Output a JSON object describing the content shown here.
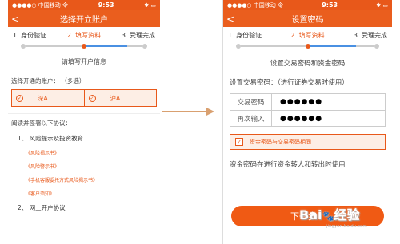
{
  "left_screen": {
    "status": {
      "carrier": "●●●●○ 中国移动 令",
      "time": "9:53",
      "battery": "✱ ▭"
    },
    "nav": {
      "back": "<",
      "title": "选择开立账户"
    },
    "steps": [
      "1. 身份验证",
      "2. 填写资料",
      "3. 受理完成"
    ],
    "subtitle": "请填写开户信息",
    "account_label": "选择开通的账户：  （多选）",
    "accounts": [
      "深A",
      "沪A"
    ],
    "agree_label": "阅读并签署以下协议：",
    "agreements": [
      {
        "title": "1、 风险提示及投资教育",
        "links": [
          "《风险揭示书》",
          "《风险警示书》",
          "《手机客服委托方式风险揭示书》",
          "《客户须知》"
        ]
      },
      {
        "title": "2、 网上开户协议",
        "links": []
      }
    ]
  },
  "right_screen": {
    "status": {
      "carrier": "●●●●○ 中国移动 令",
      "time": "9:53",
      "battery": "✱ ▭"
    },
    "nav": {
      "back": "<",
      "title": "设置密码"
    },
    "steps": [
      "1. 身份验证",
      "2. 填写资料",
      "3. 受理完成"
    ],
    "subtitle": "设置交易密码和资金密码",
    "set_trade_label": "设置交易密码：（进行证券交易时使用）",
    "fields": [
      {
        "label": "交易密码",
        "value": "●●●●●●"
      },
      {
        "label": "再次输入",
        "value": "●●●●●●"
      }
    ],
    "confirm_text": "资金密码与交易密码相同",
    "note": "资金密码在进行资金转人和转出时使用",
    "next_button": "下一步"
  },
  "watermark": {
    "brand": "Bai",
    "brand_tail": "经验",
    "sub": "jingyan.baidu.com"
  },
  "colors": {
    "accent": "#e8581a",
    "progress_blue": "#4a90e2",
    "arrow": "#d9a070"
  }
}
